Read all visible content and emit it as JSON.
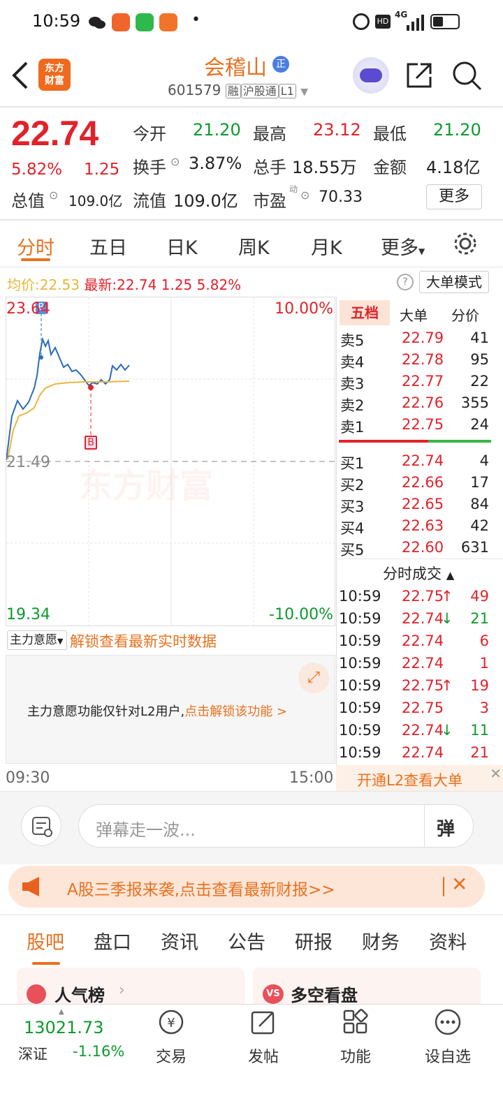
{
  "status_bar": {
    "time": "10:59",
    "network": "4G",
    "dot": "•"
  },
  "header": {
    "logo_line1": "东方",
    "logo_line2": "财富",
    "stock_name": "会稽山",
    "badge": "正",
    "code": "601579",
    "tags": [
      "融",
      "沪股通",
      "L1"
    ]
  },
  "quote": {
    "price": "22.74",
    "change_pct": "5.82%",
    "change": "1.25",
    "open_label": "今开",
    "open": "21.20",
    "high_label": "最高",
    "high": "23.12",
    "low_label": "最低",
    "low": "21.20",
    "turnover_label": "换手",
    "turnover": "3.87%",
    "volume_label": "总手",
    "volume": "18.55万",
    "amount_label": "金额",
    "amount": "4.18亿",
    "mcap_label": "总值",
    "mcap": "109.0亿",
    "float_label": "流值",
    "float_cap": "109.0亿",
    "pe_label": "市盈",
    "pe_sup": "动",
    "pe": "70.33",
    "more_button": "更多"
  },
  "tabs": [
    "分时",
    "五日",
    "日K",
    "周K",
    "月K",
    "更多"
  ],
  "info_line": {
    "avg_label": "均价:",
    "avg": "22.53",
    "latest_label": "最新:",
    "latest": "22.74",
    "chg": "1.25",
    "pct": "5.82%",
    "mode_button": "大单模式"
  },
  "intraday_chart": {
    "y_top": "23.64",
    "y_mid": "21.49",
    "y_bottom": "19.34",
    "pct_top": "10.00%",
    "pct_bottom": "-10.00%",
    "time_start": "09:30",
    "time_end": "15:00",
    "watermark": "东方财富",
    "buy_marker": "B",
    "sell_marker": "B"
  },
  "indicator": {
    "select": "主力意愿",
    "unlock_text": "解锁查看最新实时数据",
    "panel_text": "主力意愿功能仅针对L2用户,",
    "panel_link": "点击解锁该功能 >"
  },
  "order_book": {
    "tabs": [
      "五档",
      "大单",
      "分价"
    ],
    "asks": [
      {
        "label": "卖5",
        "price": "22.79",
        "vol": "41"
      },
      {
        "label": "卖4",
        "price": "22.78",
        "vol": "95"
      },
      {
        "label": "卖3",
        "price": "22.77",
        "vol": "22"
      },
      {
        "label": "卖2",
        "price": "22.76",
        "vol": "355"
      },
      {
        "label": "卖1",
        "price": "22.75",
        "vol": "24"
      }
    ],
    "bids": [
      {
        "label": "买1",
        "price": "22.74",
        "vol": "4"
      },
      {
        "label": "买2",
        "price": "22.66",
        "vol": "17"
      },
      {
        "label": "买3",
        "price": "22.65",
        "vol": "84"
      },
      {
        "label": "买4",
        "price": "22.63",
        "vol": "42"
      },
      {
        "label": "买5",
        "price": "22.60",
        "vol": "631"
      }
    ]
  },
  "ticks": {
    "title": "分时成交",
    "rows": [
      {
        "time": "10:59",
        "price": "22.75",
        "dir": "↑",
        "vol": "49"
      },
      {
        "time": "10:59",
        "price": "22.74",
        "dir": "↓",
        "vol": "21"
      },
      {
        "time": "10:59",
        "price": "22.74",
        "dir": "",
        "vol": "6"
      },
      {
        "time": "10:59",
        "price": "22.74",
        "dir": "",
        "vol": "1"
      },
      {
        "time": "10:59",
        "price": "22.75",
        "dir": "↑",
        "vol": "19"
      },
      {
        "time": "10:59",
        "price": "22.75",
        "dir": "",
        "vol": "3"
      },
      {
        "time": "10:59",
        "price": "22.74",
        "dir": "↓",
        "vol": "11"
      },
      {
        "time": "10:59",
        "price": "22.74",
        "dir": "",
        "vol": "21"
      }
    ],
    "l2_banner": "开通L2查看大单"
  },
  "comment": {
    "placeholder": "弹幕走一波...",
    "toggle": "弹"
  },
  "notice": {
    "text": "A股三季报来袭,点击查看最新财报>>"
  },
  "section_tabs": [
    "股吧",
    "盘口",
    "资讯",
    "公告",
    "研报",
    "财务",
    "资料"
  ],
  "cards": {
    "left": "人气榜",
    "right": "多空看盘",
    "right_badge": "VS"
  },
  "bottom_nav": {
    "index_value": "13021.73",
    "index_name": "深证",
    "index_change": "-1.16%",
    "items": [
      "交易",
      "发帖",
      "功能",
      "设自选"
    ]
  },
  "colors": {
    "up": "#e1222a",
    "down": "#0c9a2d",
    "accent": "#e8711f",
    "price_line": "#2a6bbf",
    "avg_line": "#e9b63b"
  }
}
